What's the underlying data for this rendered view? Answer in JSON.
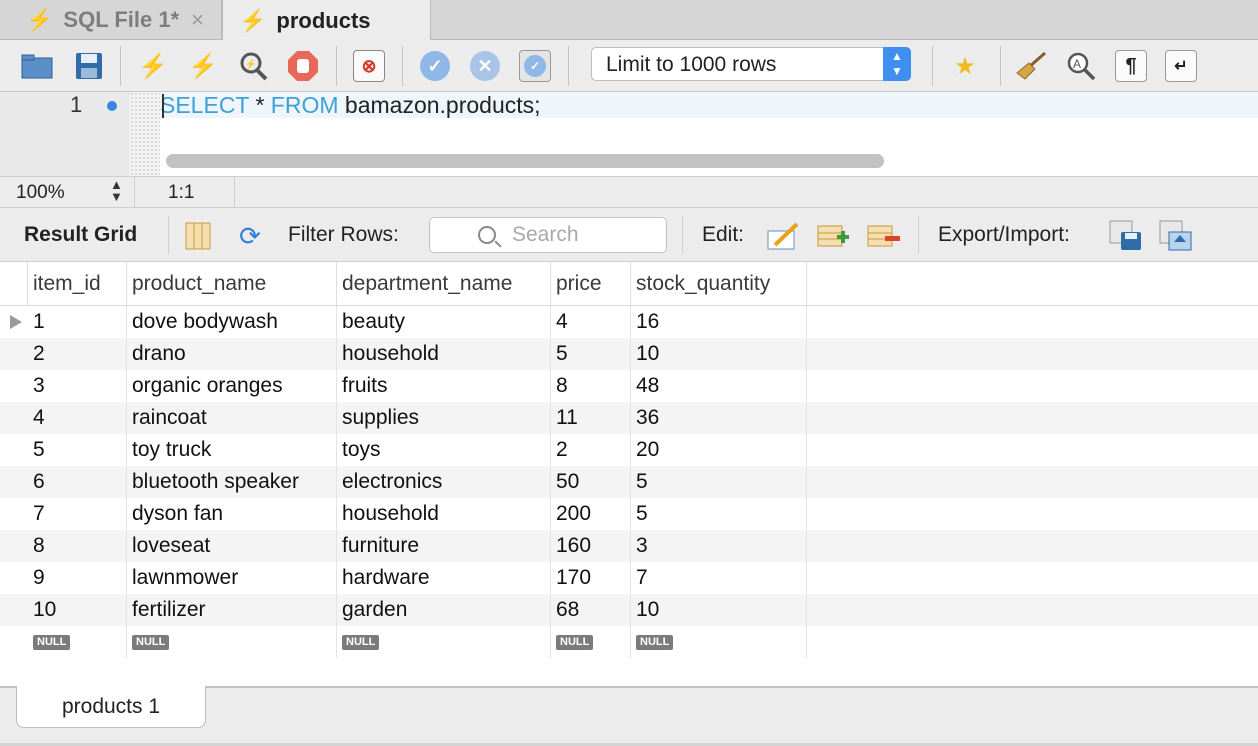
{
  "tabs": [
    {
      "label": "SQL File 1*",
      "active": false
    },
    {
      "label": "products",
      "active": true
    }
  ],
  "toolbar": {
    "limit_value": "Limit to 1000 rows",
    "icons": [
      "open-folder-icon",
      "save-icon",
      "execute-icon",
      "execute-current-icon",
      "explain-icon",
      "stop-icon",
      "toggle-error-icon",
      "commit-icon",
      "rollback-icon",
      "autocommit-icon",
      "add-snippet-icon",
      "beautify-icon",
      "find-icon",
      "invisible-chars-icon",
      "wrap-lines-icon"
    ]
  },
  "editor": {
    "line_number": "1",
    "keyword1": "SELECT",
    "middle": " * ",
    "keyword2": "FROM",
    "rest": " bamazon.products;"
  },
  "status": {
    "zoom": "100%",
    "position": "1:1"
  },
  "result_toolbar": {
    "title": "Result Grid",
    "filter_label": "Filter Rows:",
    "search_placeholder": "Search",
    "edit_label": "Edit:",
    "export_label": "Export/Import:"
  },
  "grid": {
    "columns": [
      "item_id",
      "product_name",
      "department_name",
      "price",
      "stock_quantity"
    ],
    "rows": [
      [
        "1",
        "dove bodywash",
        "beauty",
        "4",
        "16"
      ],
      [
        "2",
        "drano",
        "household",
        "5",
        "10"
      ],
      [
        "3",
        "organic oranges",
        "fruits",
        "8",
        "48"
      ],
      [
        "4",
        "raincoat",
        "supplies",
        "11",
        "36"
      ],
      [
        "5",
        "toy truck",
        "toys",
        "2",
        "20"
      ],
      [
        "6",
        "bluetooth speaker",
        "electronics",
        "50",
        "5"
      ],
      [
        "7",
        "dyson fan",
        "household",
        "200",
        "5"
      ],
      [
        "8",
        "loveseat",
        "furniture",
        "160",
        "3"
      ],
      [
        "9",
        "lawnmower",
        "hardware",
        "170",
        "7"
      ],
      [
        "10",
        "fertilizer",
        "garden",
        "68",
        "10"
      ]
    ],
    "null_label": "NULL"
  },
  "bottom_tabs": [
    {
      "label": "products 1"
    }
  ]
}
